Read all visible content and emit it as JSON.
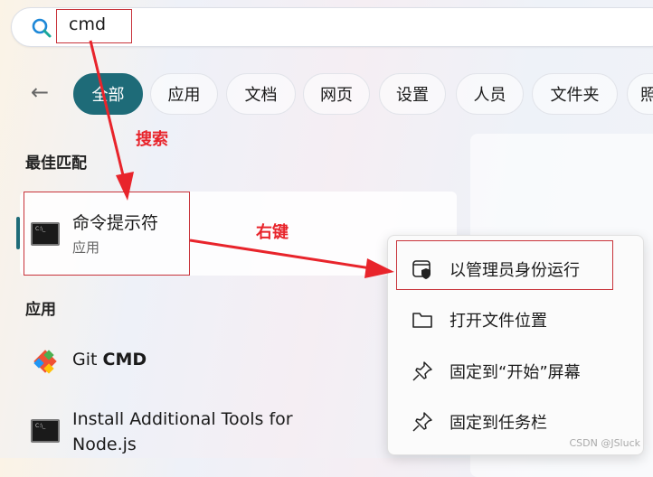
{
  "search": {
    "query": "cmd",
    "icon": "search-icon"
  },
  "filters": [
    "全部",
    "应用",
    "文档",
    "网页",
    "设置",
    "人员",
    "文件夹",
    "照"
  ],
  "best_match": {
    "heading": "最佳匹配",
    "title": "命令提示符",
    "subtitle": "应用"
  },
  "apps": {
    "heading": "应用",
    "items": [
      {
        "name_prefix": "Git ",
        "name_bold": "CMD"
      },
      {
        "line1": "Install Additional Tools for",
        "line2": "Node.js"
      }
    ]
  },
  "context_menu": [
    "以管理员身份运行",
    "打开文件位置",
    "固定到“开始”屏幕",
    "固定到任务栏"
  ],
  "annotations": {
    "search_note": "搜索",
    "right_click_note": "右键",
    "color": "#e8242b"
  },
  "watermark": "CSDN @JSluck"
}
